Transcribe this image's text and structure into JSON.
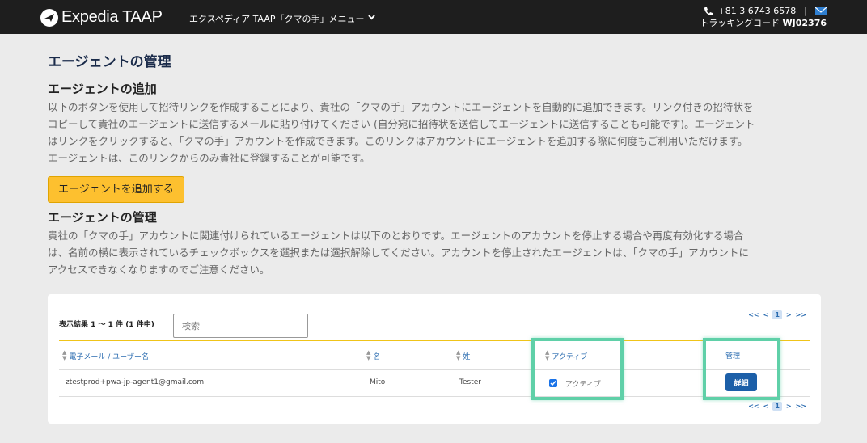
{
  "header": {
    "logo_text": "Expedia TAAP",
    "menu_label": "エクスペディア TAAP「クマの手」メニュー",
    "phone": "+81 3 6743 6578",
    "separator": "|",
    "tracking_label": "トラッキングコード",
    "tracking_code": "WJ02376"
  },
  "page": {
    "title": "エージェントの管理",
    "add_section": {
      "heading": "エージェントの追加",
      "lines": [
        "以下のボタンを使用して招待リンクを作成することにより、貴社の「クマの手」アカウントにエージェントを自動的に追加できます。リンク付きの招待状を",
        "コピーして貴社のエージェントに送信するメールに貼り付けてください (自分宛に招待状を送信してエージェントに送信することも可能です)。エージェント",
        "はリンクをクリックすると、「クマの手」アカウントを作成できます。このリンクはアカウントにエージェントを追加する際に何度もご利用いただけます。",
        "エージェントは、このリンクからのみ貴社に登録することが可能です。"
      ],
      "button_label": "エージェントを追加する"
    },
    "manage_section": {
      "heading": "エージェントの管理",
      "lines": [
        "貴社の「クマの手」アカウントに関連付けられているエージェントは以下のとおりです。エージェントのアカウントを停止する場合や再度有効化する場合",
        "は、名前の横に表示されているチェックボックスを選択または選択解除してください。アカウントを停止されたエージェントは、「クマの手」アカウントに",
        "アクセスできなくなりますのでご注意ください。"
      ]
    }
  },
  "table": {
    "results_label": "表示結果 1 〜 1 件 (1 件中)",
    "search_placeholder": "検索",
    "pager": {
      "first": "<<",
      "prev": "<",
      "current": "1",
      "next": ">",
      "last": ">>"
    },
    "columns": {
      "email": "電子メール / ユーザー名",
      "first_name": "名",
      "last_name": "姓",
      "active": "アクティブ",
      "manage": "管理"
    },
    "rows": [
      {
        "email": "ztestprod+pwa-jp-agent1@gmail.com",
        "first_name": "Mito",
        "last_name": "Tester",
        "active_checked": true,
        "active_label": "アクティブ",
        "detail_label": "詳細"
      }
    ]
  },
  "colors": {
    "header_bg": "#1e1e1e",
    "accent_yellow": "#fdc02f",
    "link_blue": "#2b6cb0",
    "button_blue": "#1c5fa8",
    "highlight_green": "#5fd0a8"
  }
}
